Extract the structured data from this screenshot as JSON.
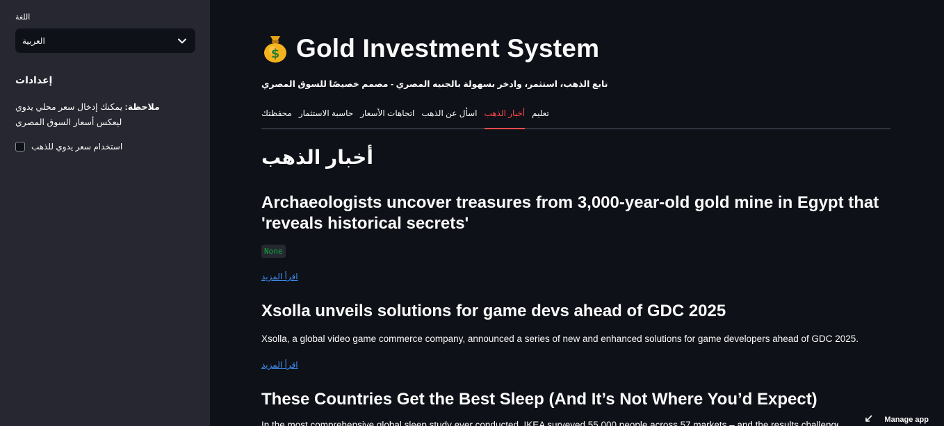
{
  "sidebar": {
    "language_label": "اللغة",
    "language_value": "العربية",
    "settings_title": "إعدادات",
    "note_bold": "ملاحظة:",
    "note_text": " يمكنك إدخال سعر محلي يدوي ليعكس أسعار السوق المصري",
    "manual_price_checkbox": "استخدام سعر يدوي للذهب"
  },
  "header": {
    "title": "Gold Investment System",
    "subtitle": "تابع الذهب، استثمر، وادخر بسهولة بالجنيه المصري - مصمم خصيصًا للسوق المصري"
  },
  "tabs": [
    {
      "label": "محفظتك",
      "active": false
    },
    {
      "label": "حاسبة الاستثمار",
      "active": false
    },
    {
      "label": "اتجاهات الأسعار",
      "active": false
    },
    {
      "label": "اسأل عن الذهب",
      "active": false
    },
    {
      "label": "أخبار الذهب",
      "active": true
    },
    {
      "label": "تعليم",
      "active": false
    }
  ],
  "news": {
    "heading": "أخبار الذهب",
    "read_more": "اقرأ المزيد",
    "articles": [
      {
        "title_line1": "Archaeologists uncover treasures from 3,000-year-old gold mine in Egypt that",
        "title_line2": "'reveals historical secrets'",
        "description": "None"
      },
      {
        "title": "Xsolla unveils solutions for game devs ahead of GDC 2025",
        "description": "Xsolla, a global video game commerce company, announced a series of new and enhanced solutions for game developers ahead of GDC 2025."
      },
      {
        "title": "These Countries Get the Best Sleep (And It’s Not Where You’d Expect)",
        "description": "In the most comprehensive global sleep study ever conducted, IKEA surveyed 55,000 people across 57 markets – and the results challenge ever..."
      }
    ]
  },
  "footer": {
    "manage_app": "Manage app"
  },
  "colors": {
    "background": "#0e1117",
    "sidebar": "#262730",
    "active_tab": "#ff4b4b",
    "link": "#3e8df3",
    "code_green": "#09ab3b"
  }
}
